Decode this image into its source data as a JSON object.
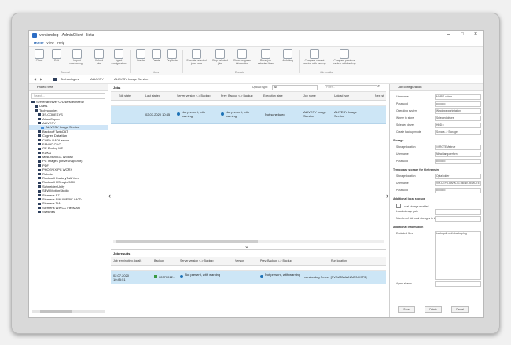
{
  "window": {
    "title": "versiondog - AdminClient - Iiota",
    "controls": {
      "minimize": "–",
      "maximize": "□",
      "close": "×"
    }
  },
  "menu": [
    "Home",
    "View",
    "Help"
  ],
  "ribbon": {
    "buttons": [
      "Clone",
      "Edit",
      "Import\nversiondog...",
      "Upload\njobs",
      "Agent\nconfiguration",
      "Create",
      "Delete",
      "Duplicate",
      "Execute selected\njobs once",
      "Stop selected\njobs",
      "Show progress\ninformation",
      "Reset job\nselected lines",
      "Archiving",
      "Compare current\nversion with backup",
      "Compare previous\nbackup with backup"
    ],
    "groups": [
      "General",
      "Jobs",
      "Execute",
      "Job results"
    ]
  },
  "address": {
    "back": "◀",
    "forward": "▶",
    "crumbs": [
      "Technologies",
      "ALUVISY",
      "ALUVISY Image Service"
    ]
  },
  "left_pane": {
    "header": "Project tree",
    "search_placeholder": "Search...",
    "tree": [
      {
        "label": "Server archive \"C:\\Users\\lechee\\D",
        "indent": 0,
        "selected": false
      },
      {
        "label": "User1",
        "indent": 1,
        "selected": false
      },
      {
        "label": "Technologies",
        "indent": 1,
        "selected": false
      },
      {
        "label": "3S-CODESYS",
        "indent": 2,
        "selected": false
      },
      {
        "label": "Atlas Copco",
        "indent": 2,
        "selected": false
      },
      {
        "label": "ALIVESY",
        "indent": 2,
        "selected": false
      },
      {
        "label": "ALIVESY Image Service",
        "indent": 3,
        "selected": true
      },
      {
        "label": "Beckhoff TwinCAT",
        "indent": 2,
        "selected": false
      },
      {
        "label": "Cognex DataMan",
        "indent": 2,
        "selected": false
      },
      {
        "label": "COPA-DATA zenon",
        "indent": 2,
        "selected": false
      },
      {
        "label": "FANUC CNC",
        "indent": 2,
        "selected": false
      },
      {
        "label": "GE Proficy ME",
        "indent": 2,
        "selected": false
      },
      {
        "label": "KUKA",
        "indent": 2,
        "selected": false
      },
      {
        "label": "Mitsubishi GX Works2",
        "indent": 2,
        "selected": false
      },
      {
        "label": "PC Images (DriveSnapShot)",
        "indent": 2,
        "selected": false
      },
      {
        "label": "PDF",
        "indent": 2,
        "selected": false
      },
      {
        "label": "PHOENIX PC WORX",
        "indent": 2,
        "selected": false
      },
      {
        "label": "Robots",
        "indent": 2,
        "selected": false
      },
      {
        "label": "Rockwell FactoryTalk View",
        "indent": 2,
        "selected": false
      },
      {
        "label": "Rockwell RSLogix 5000",
        "indent": 2,
        "selected": false
      },
      {
        "label": "Schneider Unity",
        "indent": 2,
        "selected": false
      },
      {
        "label": "SEW MotionStudio",
        "indent": 2,
        "selected": false
      },
      {
        "label": "Siemens S7",
        "indent": 2,
        "selected": false
      },
      {
        "label": "Siemens SINUMERIK 840D",
        "indent": 2,
        "selected": false
      },
      {
        "label": "Siemens TIA",
        "indent": 2,
        "selected": false
      },
      {
        "label": "Siemens WINCC FlexMAN",
        "indent": 2,
        "selected": false
      },
      {
        "label": "Switches",
        "indent": 2,
        "selected": false
      }
    ]
  },
  "jobs": {
    "title": "Jobs",
    "upload_type_label": "Upload type:",
    "upload_type_value": "All",
    "filter_placeholder": "Filter...",
    "columns": [
      "Edit state",
      "Last started",
      "Server version <-> Backup",
      "Prev. Backup <-> Backup",
      "Execution state",
      "Job name",
      "Upload type",
      "Next st"
    ],
    "row": {
      "last_started": "02.07.2020 10:45",
      "server_vs_backup": "Not present, with warning",
      "prev_vs_backup": "Not present, with warning",
      "execution_state": "Not scheduled",
      "job_name": "ALIVESY Image Service",
      "upload_type": "ALIVESY Image Service"
    }
  },
  "results": {
    "title": "Job results",
    "columns": [
      "Job terminating (local)",
      "Backup",
      "Server version <-> Backup",
      "Version",
      "Prev. Backup <-> Backup",
      "Run location"
    ],
    "row": {
      "terminated": "02.07.2020 10:45:51",
      "backup": "02070012...",
      "server_vs_backup": "Not present, with warning",
      "prev_vs_backup": "Not present, with warning",
      "run_location": "versiondog Server [SVDATAMANAG/NX9T3]"
    }
  },
  "right_pane": {
    "header": "Job configuration",
    "fields": [
      {
        "label": "Username",
        "value": "MAPIS.uchen"
      },
      {
        "label": "Password",
        "value": "••••••••••"
      },
      {
        "label": "Operating system",
        "value": "Windows workstation"
      },
      {
        "label": "Where to store",
        "value": "Selected drives"
      },
      {
        "label": "Selected drives",
        "value": "HDD:c"
      },
      {
        "label": "Create backup mode",
        "value": "Sonata -> Storage"
      }
    ],
    "storage": {
      "title": "Storage",
      "fields": [
        {
          "label": "Storage location",
          "value": "\\\\VRGTEMebrue"
        },
        {
          "label": "Username",
          "value": "NDwidangoferforn"
        },
        {
          "label": "Password",
          "value": "••••••••••"
        }
      ]
    },
    "temp_storage": {
      "title": "Temporary storage for file transfer",
      "fields": [
        {
          "label": "Storage location",
          "value": "Opta/folder"
        },
        {
          "label": "Username",
          "value": "VM-CEFO-PARK-01.04EW-REMOTE"
        },
        {
          "label": "Password",
          "value": "••••••••••"
        }
      ]
    },
    "local_storage": {
      "title": "Additional local storage",
      "checkbox": "Local storage enabled",
      "fields": [
        "Local storage path",
        "Number of old local storages to keep"
      ]
    },
    "additional": {
      "title": "Additional information",
      "excluded_label": "Excluded files",
      "excluded_value": "backupdir.xml\\nbackup.log"
    },
    "agent_label": "Agent shares",
    "buttons": [
      "Save",
      "Delete",
      "Cancel"
    ]
  }
}
